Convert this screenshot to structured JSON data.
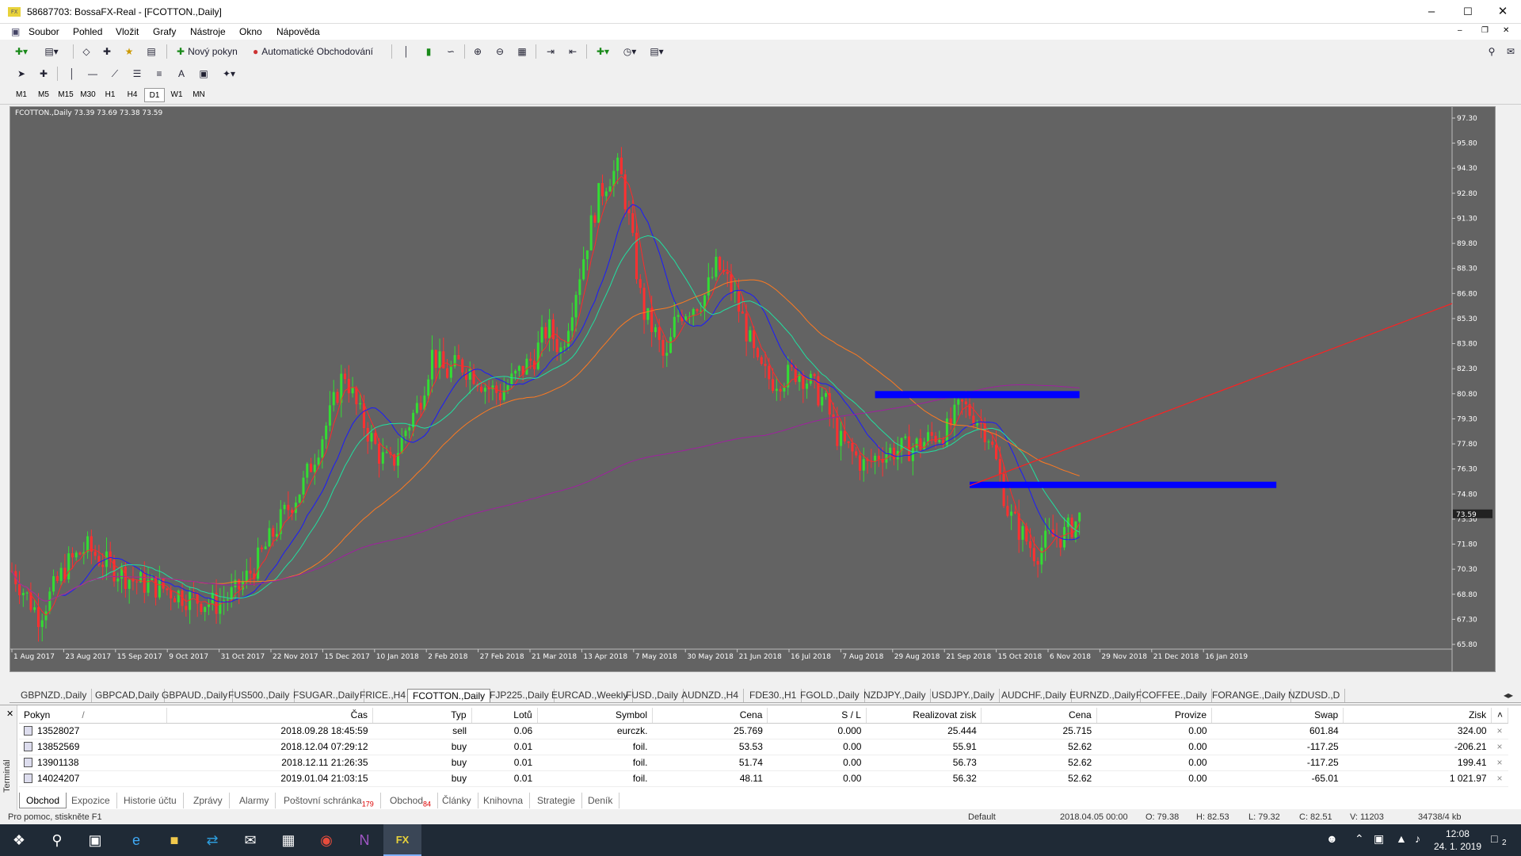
{
  "window": {
    "title": "58687703: BossaFX-Real - [FCOTTON.,Daily]",
    "app_icon": "FX"
  },
  "menu": [
    "Soubor",
    "Pohled",
    "Vložit",
    "Grafy",
    "Nástroje",
    "Okno",
    "Nápověda"
  ],
  "toolbar": {
    "new_order": "Nový pokyn",
    "auto_trading": "Automatické Obchodování",
    "draw_text": "A"
  },
  "timeframes": [
    "M1",
    "M5",
    "M15",
    "M30",
    "H1",
    "H4",
    "D1",
    "W1",
    "MN"
  ],
  "active_timeframe": "D1",
  "chart_data": {
    "type": "candlestick",
    "title": "FCOTTON.,Daily  73.39 73.69 73.38 73.59",
    "background": "#636363",
    "x_tick_labels": [
      "1 Aug 2017",
      "23 Aug 2017",
      "15 Sep 2017",
      "9 Oct 2017",
      "31 Oct 2017",
      "22 Nov 2017",
      "15 Dec 2017",
      "10 Jan 2018",
      "2 Feb 2018",
      "27 Feb 2018",
      "21 Mar 2018",
      "13 Apr 2018",
      "7 May 2018",
      "30 May 2018",
      "21 Jun 2018",
      "16 Jul 2018",
      "7 Aug 2018",
      "29 Aug 2018",
      "21 Sep 2018",
      "15 Oct 2018",
      "6 Nov 2018",
      "29 Nov 2018",
      "21 Dec 2018",
      "16 Jan 2019"
    ],
    "y_tick_labels": [
      "97.30",
      "95.80",
      "94.30",
      "92.80",
      "91.30",
      "89.80",
      "88.30",
      "86.80",
      "85.30",
      "83.80",
      "82.30",
      "80.80",
      "79.30",
      "77.80",
      "76.30",
      "74.80",
      "73.30",
      "71.80",
      "70.30",
      "68.80",
      "67.30",
      "65.80"
    ],
    "ylim": [
      65.8,
      97.3
    ],
    "current_price": "73.59",
    "close_path": [
      [
        0,
        70.2
      ],
      [
        10,
        68.8
      ],
      [
        20,
        67.5
      ],
      [
        40,
        70.5
      ],
      [
        55,
        71.6
      ],
      [
        70,
        70.6
      ],
      [
        90,
        69.6
      ],
      [
        110,
        69.2
      ],
      [
        130,
        68.6
      ],
      [
        150,
        68.2
      ],
      [
        165,
        68.9
      ],
      [
        180,
        70.6
      ],
      [
        200,
        73.5
      ],
      [
        215,
        75.4
      ],
      [
        225,
        77.5
      ],
      [
        235,
        79.6
      ],
      [
        245,
        82.2
      ],
      [
        255,
        79.8
      ],
      [
        265,
        78.1
      ],
      [
        272,
        77.0
      ],
      [
        280,
        76.5
      ],
      [
        290,
        78.6
      ],
      [
        300,
        80.2
      ],
      [
        310,
        83.2
      ],
      [
        320,
        82.0
      ],
      [
        330,
        82.6
      ],
      [
        340,
        82.1
      ],
      [
        350,
        81.2
      ],
      [
        360,
        80.8
      ],
      [
        370,
        81.7
      ],
      [
        385,
        83.0
      ],
      [
        395,
        84.8
      ],
      [
        405,
        83.4
      ],
      [
        415,
        86.8
      ],
      [
        425,
        90.2
      ],
      [
        432,
        92.5
      ],
      [
        440,
        93.8
      ],
      [
        448,
        94.3
      ],
      [
        455,
        91.2
      ],
      [
        465,
        85.8
      ],
      [
        475,
        84.3
      ],
      [
        482,
        82.5
      ],
      [
        490,
        85.5
      ],
      [
        500,
        86.0
      ],
      [
        510,
        86.5
      ],
      [
        520,
        88.5
      ],
      [
        530,
        87.2
      ],
      [
        540,
        85.0
      ],
      [
        550,
        82.3
      ],
      [
        560,
        81.6
      ],
      [
        570,
        81.8
      ],
      [
        580,
        82.2
      ],
      [
        590,
        81.3
      ],
      [
        600,
        80.2
      ],
      [
        610,
        78.0
      ],
      [
        620,
        77.2
      ],
      [
        630,
        76.4
      ],
      [
        640,
        77.3
      ],
      [
        650,
        77.4
      ],
      [
        660,
        77.5
      ],
      [
        670,
        77.8
      ],
      [
        680,
        78.3
      ],
      [
        690,
        78.6
      ],
      [
        700,
        80.1
      ],
      [
        710,
        79.5
      ],
      [
        720,
        78.4
      ],
      [
        728,
        76.0
      ],
      [
        735,
        73.6
      ],
      [
        745,
        72.4
      ],
      [
        755,
        71.2
      ],
      [
        765,
        72.2
      ],
      [
        775,
        72.3
      ],
      [
        785,
        73.2
      ],
      [
        790,
        73.6
      ]
    ],
    "horizontal_levels": [
      {
        "price": 80.75,
        "color": "#0000ff"
      },
      {
        "price": 75.35,
        "color": "#0000ff"
      }
    ],
    "trendline": {
      "color": "#ff2020",
      "from": [
        75.3
      ],
      "to": [
        86.2
      ]
    },
    "moving_averages": [
      {
        "color": "#ff2a2a"
      },
      {
        "color": "#1a1aff"
      },
      {
        "color": "#20e0a0"
      },
      {
        "color": "#ff7a20"
      },
      {
        "color": "#a020a0"
      }
    ]
  },
  "symbol_tabs": [
    "GBPNZD.,Daily",
    "GBPCAD,Daily",
    "GBPAUD.,Daily",
    "FUS500.,Daily",
    "FSUGAR.,Daily",
    "FRICE.,H4",
    "FCOTTON.,Daily",
    "FJP225.,Daily",
    "EURCAD.,Weekly",
    "FUSD.,Daily",
    "AUDNZD.,H4",
    "FDE30.,H1",
    "FGOLD.,Daily",
    "NZDJPY.,Daily",
    "USDJPY.,Daily",
    "AUDCHF.,Daily",
    "EURNZD.,Daily",
    "FCOFFEE.,Daily",
    "FORANGE.,Daily",
    "NZDUSD.,D"
  ],
  "active_symbol_tab": "FCOTTON.,Daily",
  "orders": {
    "columns": [
      "Pokyn",
      "Čas",
      "Typ",
      "Lotů",
      "Symbol",
      "Cena",
      "S / L",
      "Realizovat zisk",
      "Cena",
      "Provize",
      "Swap",
      "Zisk"
    ],
    "sort_mark": "/",
    "rows": [
      [
        "13528027",
        "2018.09.28 18:45:59",
        "sell",
        "0.06",
        "eurczk.",
        "25.769",
        "0.000",
        "25.444",
        "25.715",
        "0.00",
        "601.84",
        "324.00"
      ],
      [
        "13852569",
        "2018.12.04 07:29:12",
        "buy",
        "0.01",
        "foil.",
        "53.53",
        "0.00",
        "55.91",
        "52.62",
        "0.00",
        "-117.25",
        "-206.21"
      ],
      [
        "13901138",
        "2018.12.11 21:26:35",
        "buy",
        "0.01",
        "foil.",
        "51.74",
        "0.00",
        "56.73",
        "52.62",
        "0.00",
        "-117.25",
        "199.41"
      ],
      [
        "14024207",
        "2019.01.04 21:03:15",
        "buy",
        "0.01",
        "foil.",
        "48.11",
        "0.00",
        "56.32",
        "52.62",
        "0.00",
        "-65.01",
        "1 021.97"
      ]
    ]
  },
  "terminal_label": "Terminál",
  "bottom_tabs": [
    {
      "label": "Obchod",
      "badge": ""
    },
    {
      "label": "Expozice",
      "badge": ""
    },
    {
      "label": "Historie účtu",
      "badge": ""
    },
    {
      "label": "Zprávy",
      "badge": ""
    },
    {
      "label": "Alarmy",
      "badge": ""
    },
    {
      "label": "Poštovní schránka",
      "badge": "179"
    },
    {
      "label": "Obchod",
      "badge": "84"
    },
    {
      "label": "Články",
      "badge": ""
    },
    {
      "label": "Knihovna",
      "badge": ""
    },
    {
      "label": "Strategie",
      "badge": ""
    },
    {
      "label": "Deník",
      "badge": ""
    }
  ],
  "status": {
    "help": "Pro pomoc, stiskněte F1",
    "profile": "Default",
    "datetime": "2018.04.05 00:00",
    "open": "O: 79.38",
    "high": "H: 82.53",
    "low": "L: 79.32",
    "close": "C: 82.51",
    "volume": "V: 11203",
    "traffic": "34738/4 kb"
  },
  "taskbar": {
    "time": "12:08",
    "date": "24. 1. 2019",
    "notifications": "2"
  }
}
